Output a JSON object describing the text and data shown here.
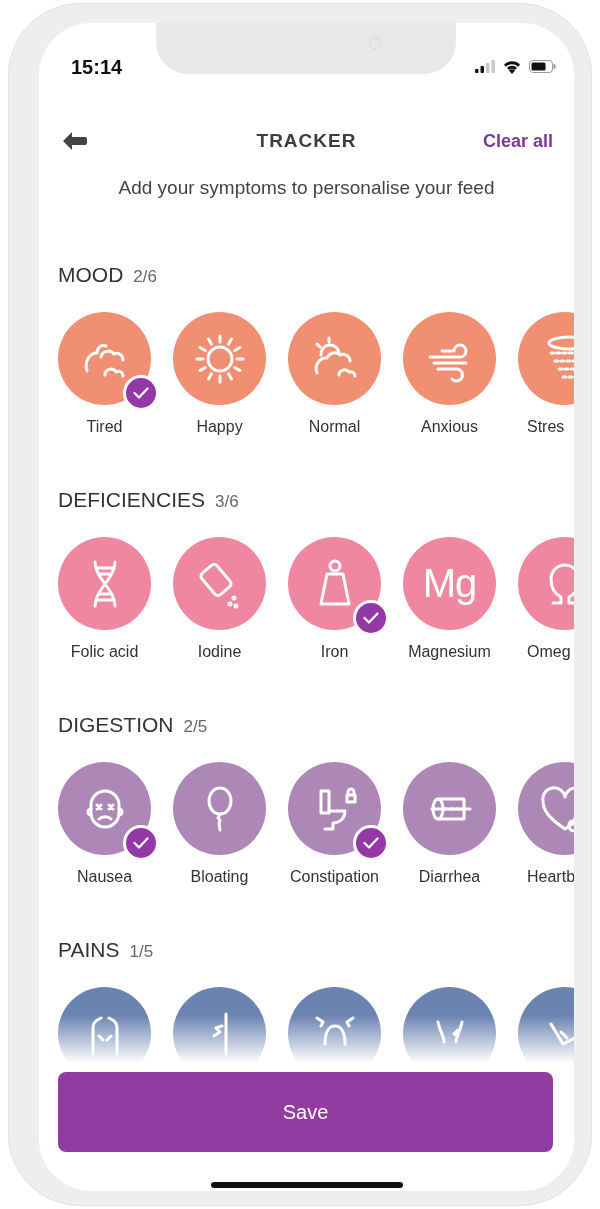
{
  "status_bar": {
    "time": "15:14"
  },
  "header": {
    "title": "TRACKER",
    "action": "Clear all"
  },
  "subtitle": "Add your symptoms to personalise your feed",
  "sections": [
    {
      "title": "MOOD",
      "count": "2/6",
      "color": "#f08f72",
      "items": [
        {
          "kind": "labelled",
          "label": "Tired",
          "selected": true
        },
        {
          "kind": "labelled",
          "label": "Happy",
          "selected": false
        },
        {
          "kind": "labelled",
          "label": "Normal",
          "selected": false
        },
        {
          "kind": "labelled",
          "label": "Anxious",
          "selected": false
        },
        {
          "kind": "labelled",
          "label": "Stres"
        }
      ]
    },
    {
      "title": "DEFICIENCIES",
      "count": "3/6",
      "color": "#ef87a0",
      "items": [
        {
          "kind": "labelled",
          "label": "Folic acid",
          "selected": false
        },
        {
          "kind": "labelled",
          "label": "Iodine",
          "selected": false
        },
        {
          "kind": "labelled",
          "label": "Iron",
          "selected": true
        },
        {
          "kind": "labelled",
          "label": "Magnesium",
          "symbol": "Mg",
          "selected": false
        },
        {
          "kind": "labelled",
          "label": "Omeg"
        }
      ]
    },
    {
      "title": "DIGESTION",
      "count": "2/5",
      "color": "#ad88b6",
      "items": [
        {
          "kind": "labelled",
          "label": "Nausea",
          "selected": true
        },
        {
          "kind": "labelled",
          "label": "Bloating",
          "selected": false
        },
        {
          "kind": "labelled",
          "label": "Constipation",
          "selected": true
        },
        {
          "kind": "labelled",
          "label": "Diarrhea",
          "selected": false
        },
        {
          "kind": "labelled",
          "label": "Heartb"
        }
      ]
    },
    {
      "title": "PAINS",
      "count": "1/5",
      "color": "#6b83b1",
      "items": [
        {
          "kind": "faded"
        },
        {
          "kind": "faded"
        },
        {
          "kind": "faded"
        },
        {
          "kind": "faded"
        },
        {
          "kind": "faded"
        }
      ]
    }
  ],
  "save_button": "Save"
}
